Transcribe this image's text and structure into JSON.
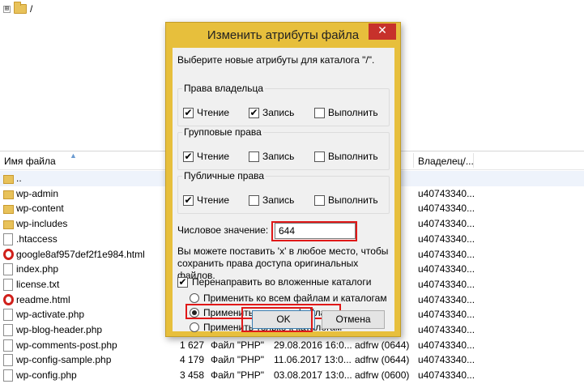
{
  "tree": {
    "expander": "⊞",
    "path": "/"
  },
  "columns": {
    "filename": "Имя файла",
    "owner": "Владелец/..."
  },
  "files": [
    {
      "name": "..",
      "icon": "folder-icon",
      "size": "",
      "type": "",
      "date": "",
      "perms": "",
      "owner": ""
    },
    {
      "name": "wp-admin",
      "icon": "folder-icon",
      "size": "",
      "type": "",
      "date": "",
      "perms": "",
      "owner": "u40743340..."
    },
    {
      "name": "wp-content",
      "icon": "folder-icon",
      "size": "",
      "type": "",
      "date": "",
      "perms": "",
      "owner": "u40743340..."
    },
    {
      "name": "wp-includes",
      "icon": "folder-icon",
      "size": "",
      "type": "",
      "date": "",
      "perms": "",
      "owner": "u40743340..."
    },
    {
      "name": ".htaccess",
      "icon": "document-icon",
      "size": "",
      "type": "",
      "date": "",
      "perms": "",
      "owner": "u40743340..."
    },
    {
      "name": "google8af957def2f1e984.html",
      "icon": "opera-icon",
      "size": "",
      "type": "",
      "date": "",
      "perms": "",
      "owner": "u40743340..."
    },
    {
      "name": "index.php",
      "icon": "document-icon",
      "size": "",
      "type": "",
      "date": "",
      "perms": "",
      "owner": "u40743340..."
    },
    {
      "name": "license.txt",
      "icon": "document-icon",
      "size": "",
      "type": "",
      "date": "",
      "perms": "",
      "owner": "u40743340..."
    },
    {
      "name": "readme.html",
      "icon": "opera-icon",
      "size": "",
      "type": "",
      "date": "",
      "perms": "",
      "owner": "u40743340..."
    },
    {
      "name": "wp-activate.php",
      "icon": "document-icon",
      "size": "",
      "type": "",
      "date": "",
      "perms": "",
      "owner": "u40743340..."
    },
    {
      "name": "wp-blog-header.php",
      "icon": "document-icon",
      "size": "",
      "type": "",
      "date": "",
      "perms": "",
      "owner": "u40743340..."
    },
    {
      "name": "wp-comments-post.php",
      "icon": "document-icon",
      "size": "1 627",
      "type": "Файл \"PHP\"",
      "date": "29.08.2016 16:0...",
      "perms": "adfrw (0644)",
      "owner": "u40743340..."
    },
    {
      "name": "wp-config-sample.php",
      "icon": "document-icon",
      "size": "4 179",
      "type": "Файл \"PHP\"",
      "date": "11.06.2017 13:0...",
      "perms": "adfrw (0644)",
      "owner": "u40743340..."
    },
    {
      "name": "wp-config.php",
      "icon": "document-icon",
      "size": "3 458",
      "type": "Файл \"PHP\"",
      "date": "03.08.2017 13:0...",
      "perms": "adfrw (0600)",
      "owner": "u40743340..."
    }
  ],
  "dialog": {
    "title": "Изменить атрибуты файла",
    "close": "✕",
    "prompt": "Выберите новые атрибуты для каталога \"/\".",
    "groups": [
      {
        "title": "Права владельца",
        "read": "Чтение",
        "read_checked": true,
        "write": "Запись",
        "write_checked": true,
        "exec": "Выполнить",
        "exec_checked": false
      },
      {
        "title": "Групповые права",
        "read": "Чтение",
        "read_checked": true,
        "write": "Запись",
        "write_checked": false,
        "exec": "Выполнить",
        "exec_checked": false
      },
      {
        "title": "Публичные права",
        "read": "Чтение",
        "read_checked": true,
        "write": "Запись",
        "write_checked": false,
        "exec": "Выполнить",
        "exec_checked": false
      }
    ],
    "numeric_label": "Числовое значение:",
    "numeric_value": "644",
    "note": "Вы можете поставить 'x' в любое место, чтобы сохранить права доступа оригинальных файлов.",
    "recurse_label": "Перенаправить во вложенные каталоги",
    "recurse_checked": true,
    "radio_options": [
      {
        "label": "Применить ко всем файлам и каталогам",
        "selected": false
      },
      {
        "label": "Применить только к файлам",
        "selected": true
      },
      {
        "label": "Применить только к каталогам",
        "selected": false
      }
    ],
    "ok_label": "OK",
    "cancel_label": "Отмена"
  },
  "colors": {
    "highlight": "#e01818",
    "dialog_frame": "#e7bf3c",
    "close": "#c7312b"
  }
}
